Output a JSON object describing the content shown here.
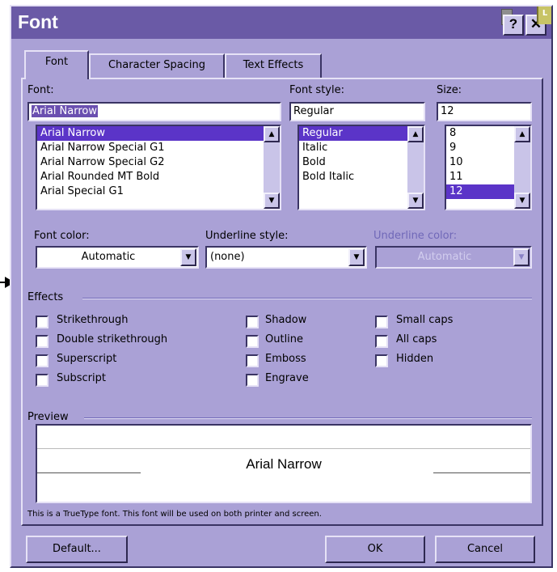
{
  "window": {
    "title": "Font",
    "help_glyph": "?",
    "close_glyph": "✕",
    "corner_letter": "L"
  },
  "tabs": [
    {
      "label": "Font",
      "active": true
    },
    {
      "label": "Character Spacing",
      "active": false
    },
    {
      "label": "Text Effects",
      "active": false
    }
  ],
  "font": {
    "label": "Font:",
    "value": "Arial Narrow",
    "list": [
      "Arial Narrow",
      "Arial Narrow Special G1",
      "Arial Narrow Special G2",
      "Arial Rounded MT Bold",
      "Arial Special G1"
    ],
    "selected": "Arial Narrow"
  },
  "font_style": {
    "label": "Font style:",
    "value": "Regular",
    "list": [
      "Regular",
      "Italic",
      "Bold",
      "Bold Italic"
    ],
    "selected": "Regular"
  },
  "size": {
    "label": "Size:",
    "value": "12",
    "list": [
      "8",
      "9",
      "10",
      "11",
      "12"
    ],
    "selected": "12"
  },
  "font_color": {
    "label": "Font color:",
    "value": "Automatic"
  },
  "underline_style": {
    "label": "Underline style:",
    "value": "(none)"
  },
  "underline_color": {
    "label": "Underline color:",
    "value": "Automatic",
    "disabled": true
  },
  "effects": {
    "label": "Effects",
    "col1": [
      "Strikethrough",
      "Double strikethrough",
      "Superscript",
      "Subscript"
    ],
    "col2": [
      "Shadow",
      "Outline",
      "Emboss",
      "Engrave"
    ],
    "col3": [
      "Small caps",
      "All caps",
      "Hidden"
    ]
  },
  "preview": {
    "label": "Preview",
    "text": "Arial Narrow"
  },
  "info_text": "This is a TrueType font. This font will be used on both printer and screen.",
  "buttons": {
    "default": "Default...",
    "ok": "OK",
    "cancel": "Cancel"
  },
  "colors": {
    "face": "#aaa1d6",
    "title_bar": "#6a5aa6",
    "highlight": "#5b34c8"
  },
  "icons": {
    "arrow": "right-arrow-icon",
    "dropdown": "chevron-down-icon",
    "scroll_up": "scroll-up-icon",
    "scroll_down": "scroll-down-icon"
  }
}
